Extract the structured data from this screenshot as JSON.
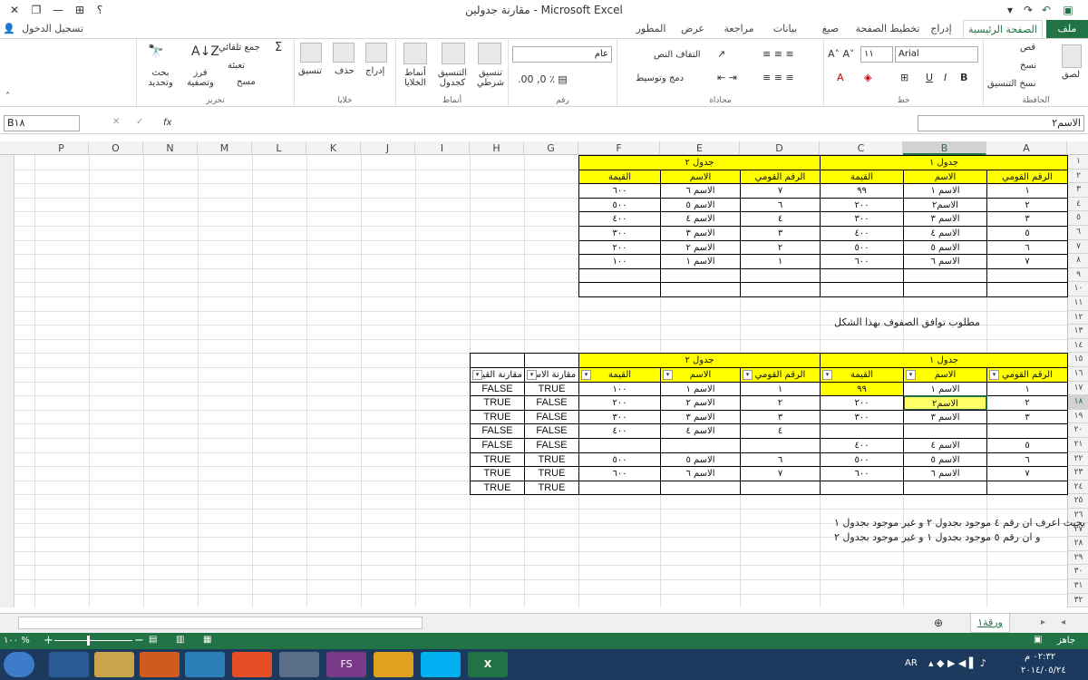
{
  "window": {
    "title": "مقارنة جدولين - Microsoft Excel",
    "help": "؟",
    "signin": "تسجيل الدخول"
  },
  "tabs": [
    {
      "label": "ملف"
    },
    {
      "label": "الصفحة الرئيسية"
    },
    {
      "label": "إدراج"
    },
    {
      "label": "تخطيط الصفحة"
    },
    {
      "label": "صيغ"
    },
    {
      "label": "بيانات"
    },
    {
      "label": "مراجعة"
    },
    {
      "label": "عرض"
    },
    {
      "label": "المطور"
    }
  ],
  "ribbon": {
    "clipboard": {
      "label": "الحافظة",
      "paste": "لصق",
      "cut": "قص",
      "copy": "نسخ",
      "format_painter": "نسخ التنسيق"
    },
    "font": {
      "label": "خط",
      "name": "Arial",
      "size": "١١"
    },
    "alignment": {
      "label": "محاذاة",
      "wrap": "التفاف النص",
      "merge": "دمج وتوسيط"
    },
    "number": {
      "label": "رقم",
      "format": "عام"
    },
    "styles": {
      "label": "أنماط",
      "conditional": "تنسيق شرطي",
      "table": "التنسيق كجدول",
      "cell": "أنماط الخلايا"
    },
    "cells": {
      "label": "خلايا",
      "insert": "إدراج",
      "delete": "حذف",
      "format": "تنسيق"
    },
    "editing": {
      "label": "تحرير",
      "autosum": "جمع تلقائي",
      "fill": "تعبئة",
      "clear": "مسح",
      "sort": "فرز وتصفية",
      "find": "بحث وتحديد"
    }
  },
  "formula_bar": {
    "name_box": "B١٨",
    "formula": "الاسم٢",
    "fx": "fx"
  },
  "columns": [
    "A",
    "B",
    "C",
    "D",
    "E",
    "F",
    "G",
    "H",
    "I",
    "J",
    "K",
    "L",
    "M",
    "N",
    "O",
    "P"
  ],
  "rows": [
    "١",
    "٢",
    "٣",
    "٤",
    "٥",
    "٦",
    "٧",
    "٨",
    "٩",
    "١٠",
    "١١",
    "١٢",
    "١٣",
    "١٤",
    "١٥",
    "١٦",
    "١٧",
    "١٨",
    "١٩",
    "٢٠",
    "٢١",
    "٢٢",
    "٢٣",
    "٢٤",
    "٢٥",
    "٢٦",
    "٢٧",
    "٢٨",
    "٢٩",
    "٣٠",
    "٣١",
    "٣٢"
  ],
  "table_top": {
    "t1_title": "جدول ١",
    "t2_title": "جدول ٢",
    "headers": [
      "الرقم القومي",
      "الاسم",
      "القيمة",
      "الرقم القومي",
      "الاسم",
      "القيمة"
    ],
    "rows": [
      [
        "١",
        "الاسم ١",
        "٩٩",
        "٧",
        "الاسم ٦",
        "٦٠٠"
      ],
      [
        "٢",
        "الاسم٢",
        "٢٠٠",
        "٦",
        "الاسم ٥",
        "٥٠٠"
      ],
      [
        "٣",
        "الاسم ٣",
        "٣٠٠",
        "٤",
        "الاسم ٤",
        "٤٠٠"
      ],
      [
        "٥",
        "الاسم ٤",
        "٤٠٠",
        "٣",
        "الاسم ٣",
        "٣٠٠"
      ],
      [
        "٦",
        "الاسم ٥",
        "٥٠٠",
        "٢",
        "الاسم ٢",
        "٢٠٠"
      ],
      [
        "٧",
        "الاسم ٦",
        "٦٠٠",
        "١",
        "الاسم ١",
        "١٠٠"
      ]
    ]
  },
  "note1": "مطلوب توافق الصفوف بهذا الشكل",
  "table_bottom": {
    "t1_title": "جدول ١",
    "t2_title": "جدول ٢",
    "headers": [
      "الرقم القومي",
      "الاسم",
      "القيمة",
      "الرقم القومي",
      "الاسم",
      "القيمة",
      "مقارنة الاسم",
      "مقارنة القيمة"
    ],
    "rows": [
      [
        "١",
        "الاسم ١",
        "٩٩",
        "١",
        "الاسم ١",
        "١٠٠",
        "TRUE",
        "FALSE"
      ],
      [
        "٢",
        "الاسم٢",
        "٢٠٠",
        "٢",
        "الاسم ٢",
        "٢٠٠",
        "FALSE",
        "TRUE"
      ],
      [
        "٣",
        "الاسم ٣",
        "٣٠٠",
        "٣",
        "الاسم ٣",
        "٣٠٠",
        "FALSE",
        "TRUE"
      ],
      [
        "",
        "",
        "",
        "٤",
        "الاسم ٤",
        "٤٠٠",
        "FALSE",
        "FALSE"
      ],
      [
        "٥",
        "الاسم ٤",
        "٤٠٠",
        "",
        "",
        "",
        "FALSE",
        "FALSE"
      ],
      [
        "٦",
        "الاسم ٥",
        "٥٠٠",
        "٦",
        "الاسم ٥",
        "٥٠٠",
        "TRUE",
        "TRUE"
      ],
      [
        "٧",
        "الاسم ٦",
        "٦٠٠",
        "٧",
        "الاسم ٦",
        "٦٠٠",
        "TRUE",
        "TRUE"
      ],
      [
        "",
        "",
        "",
        "",
        "",
        "",
        "TRUE",
        "TRUE"
      ]
    ]
  },
  "note2": "بحيث اعرف ان رقم ٤ موجود بجدول ٢ و غير موجود بجدول ١",
  "note3": "و ان رقم ٥ موجود بجدول ١ و غير موجود بجدول ٢",
  "sheet": {
    "tab": "ورقة١",
    "status": "جاهز",
    "zoom": "١٠٠ %"
  },
  "taskbar": {
    "lang": "AR",
    "time": "٠٢:٣٢ م",
    "date": "٢٠١٤/٠٥/٢٤"
  }
}
